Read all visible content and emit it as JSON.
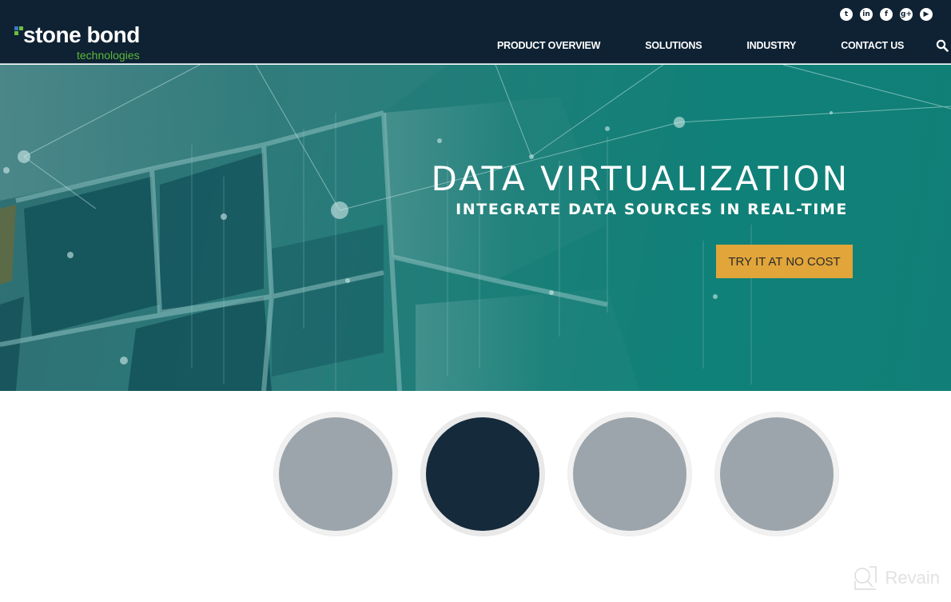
{
  "header": {
    "logo": {
      "main": "stone bond",
      "sub": "technologies"
    },
    "social": [
      {
        "name": "twitter-icon",
        "glyph": "t"
      },
      {
        "name": "linkedin-icon",
        "glyph": "in"
      },
      {
        "name": "facebook-icon",
        "glyph": "f"
      },
      {
        "name": "google-plus-icon",
        "glyph": "g+"
      },
      {
        "name": "youtube-icon",
        "glyph": "▶"
      }
    ],
    "nav": [
      {
        "label": "PRODUCT OVERVIEW"
      },
      {
        "label": "SOLUTIONS"
      },
      {
        "label": "INDUSTRY"
      },
      {
        "label": "CONTACT US"
      }
    ]
  },
  "hero": {
    "title": "DATA VIRTUALIZATION",
    "subtitle": "INTEGRATE DATA SOURCES IN REAL-TIME",
    "cta_label": "TRY IT AT NO COST"
  },
  "carousel": {
    "colors": {
      "inactive": "#9ca5ab",
      "active": "#152a3b"
    },
    "active_index": 1,
    "count": 4
  },
  "watermark": {
    "text": "Revain"
  }
}
